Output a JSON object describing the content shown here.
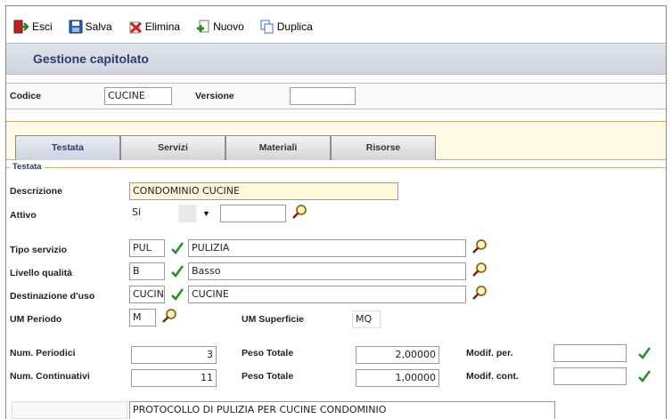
{
  "toolbar": {
    "esci": "Esci",
    "salva": "Salva",
    "elimina": "Elimina",
    "nuovo": "Nuovo",
    "duplica": "Duplica"
  },
  "page": {
    "title": "Gestione capitolato"
  },
  "header": {
    "codice_label": "Codice",
    "codice_value": "CUCINE",
    "versione_label": "Versione",
    "versione_value": ""
  },
  "tabs": [
    {
      "label": "Testata",
      "active": true
    },
    {
      "label": "Servizi",
      "active": false
    },
    {
      "label": "Materiali",
      "active": false
    },
    {
      "label": "Risorse",
      "active": false
    }
  ],
  "section": {
    "legend": "Testata"
  },
  "form": {
    "descrizione_label": "Descrizione",
    "descrizione_value": "CONDOMINIO CUCINE",
    "attivo_label": "Attivo",
    "attivo_value": "Si",
    "attivo_extra": "",
    "tipo_servizio_label": "Tipo servizio",
    "tipo_servizio_code": "PUL",
    "tipo_servizio_desc": "PULIZIA",
    "livello_qualita_label": "Livello qualità",
    "livello_qualita_code": "B",
    "livello_qualita_desc": "Basso",
    "destinazione_label": "Destinazione d'uso",
    "destinazione_code": "CUCIN",
    "destinazione_desc": "CUCINE",
    "um_periodo_label": "UM Periodo",
    "um_periodo_value": "M",
    "um_superficie_label": "UM Superficie",
    "um_superficie_value": "MQ",
    "num_periodici_label": "Num. Periodici",
    "num_periodici_value": "3",
    "peso_totale_label_1": "Peso Totale",
    "peso_totale_value_1": "2,00000",
    "modif_per_label": "Modif. per.",
    "modif_per_value": "",
    "num_continuativi_label": "Num. Continuativi",
    "num_continuativi_value": "11",
    "peso_totale_label_2": "Peso Totale",
    "peso_totale_value_2": "1,00000",
    "modif_cont_label": "Modif. cont.",
    "modif_cont_value": "",
    "note_value": "PROTOCOLLO DI PULIZIA PER CUCINE CONDOMINIO"
  },
  "colors": {
    "title": "#2d3c6e",
    "check": "#2e8b2e",
    "tab_border": "#c9a96e"
  }
}
